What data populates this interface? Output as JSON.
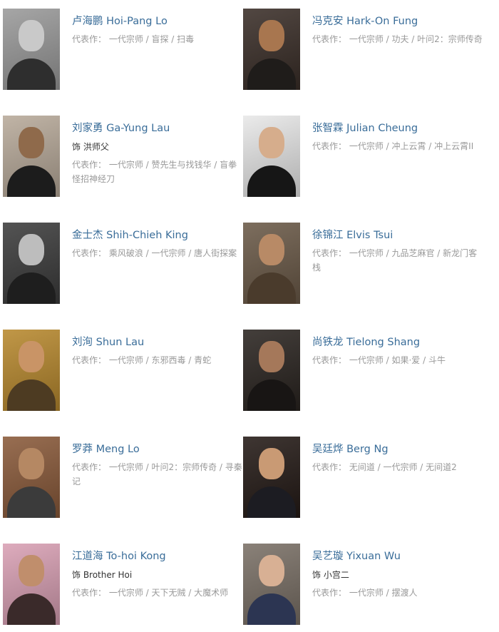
{
  "cast": [
    {
      "name": "卢海鹏 Hoi-Pang Lo",
      "role": "",
      "works": "代表作： 一代宗师 / 盲探 / 扫毒",
      "photo": {
        "bg": "#9a9a9a",
        "skin": "#c9c9c9",
        "cloth": "#2e2e2e"
      }
    },
    {
      "name": "冯克安 Hark-On Fung",
      "role": "",
      "works": "代表作： 一代宗师 / 功夫 / 叶问2：宗师传奇",
      "photo": {
        "bg": "#3a2e28",
        "skin": "#a8764f",
        "cloth": "#1f1c1a"
      }
    },
    {
      "name": "刘家勇 Ga-Yung Lau",
      "role": "饰 洪师父",
      "works": "代表作： 一代宗师 / 赞先生与找钱华 / 盲拳怪招神经刀",
      "photo": {
        "bg": "#b8aa9a",
        "skin": "#8f6a4b",
        "cloth": "#1c1c1c"
      }
    },
    {
      "name": "张智霖 Julian Cheung",
      "role": "",
      "works": "代表作： 一代宗师 / 冲上云霄 / 冲上云霄II",
      "photo": {
        "bg": "#e8e8e8",
        "skin": "#d6ad8c",
        "cloth": "#161616"
      }
    },
    {
      "name": "金士杰 Shih-Chieh King",
      "role": "",
      "works": "代表作： 乘风破浪 / 一代宗师 / 唐人街探案",
      "photo": {
        "bg": "#3c3c3c",
        "skin": "#bdbdbd",
        "cloth": "#1e1e1e"
      }
    },
    {
      "name": "徐锦江 Elvis Tsui",
      "role": "",
      "works": "代表作： 一代宗师 / 九品芝麻官 / 新龙门客栈",
      "photo": {
        "bg": "#6b5a48",
        "skin": "#b88a66",
        "cloth": "#4a3b2c"
      }
    },
    {
      "name": "刘洵 Shun Lau",
      "role": "",
      "works": "代表作： 一代宗师 / 东邪西毒 / 青蛇",
      "photo": {
        "bg": "#b8892e",
        "skin": "#c99466",
        "cloth": "#4d3b22"
      }
    },
    {
      "name": "尚铁龙 Tielong Shang",
      "role": "",
      "works": "代表作： 一代宗师 / 如果·爱 / 斗牛",
      "photo": {
        "bg": "#2a2420",
        "skin": "#a5785a",
        "cloth": "#181514"
      }
    },
    {
      "name": "罗莽 Meng Lo",
      "role": "",
      "works": "代表作： 一代宗师 / 叶问2：宗师传奇 / 寻秦记",
      "photo": {
        "bg": "#8a5a3a",
        "skin": "#b58863",
        "cloth": "#3b3b3b"
      }
    },
    {
      "name": "吴廷烨 Berg Ng",
      "role": "",
      "works": "代表作： 无间道 / 一代宗师 / 无间道2",
      "photo": {
        "bg": "#241a16",
        "skin": "#c99a74",
        "cloth": "#1c1c22"
      }
    },
    {
      "name": "江道海 To-hoi Kong",
      "role": "饰 Brother Hoi",
      "works": "代表作： 一代宗师 / 天下无贼 / 大魔术师",
      "photo": {
        "bg": "#d9a0b4",
        "skin": "#c08e6c",
        "cloth": "#3a2a2a"
      }
    },
    {
      "name": "吴艺璇 Yixuan Wu",
      "role": "饰 小宫二",
      "works": "代表作： 一代宗师 / 摆渡人",
      "photo": {
        "bg": "#7a7066",
        "skin": "#d8b094",
        "cloth": "#2c3552"
      }
    }
  ]
}
